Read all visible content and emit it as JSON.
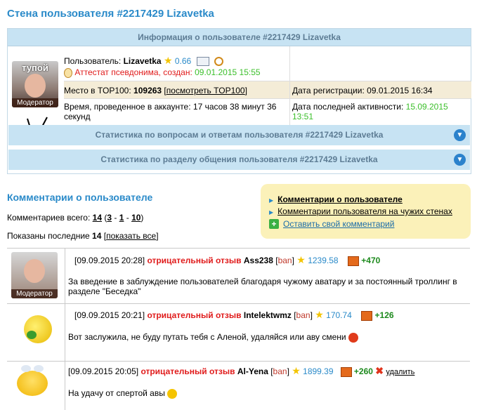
{
  "page_title": "Стена пользователя #2217429 Lizavetka",
  "info": {
    "header": "Информация о пользователе #2217429 Lizavetka",
    "avatar_caption_top": "тупой",
    "avatar_caption": "Модератор",
    "user_label": "Пользователь:",
    "user_name": "Lizavetka",
    "user_rating": "0.66",
    "attest_label": "Аттестат псевдонима, создан:",
    "attest_date": "09.01.2015 15:55",
    "top_label": "Место в TOP100:",
    "top_value": "109263",
    "top_link": "посмотреть TOP100",
    "reg_label": "Дата регистрации:",
    "reg_value": "09.01.2015 16:34",
    "time_label": "Время, проведенное в аккаунте:",
    "time_value": "17 часов 38 минут 36 секунд",
    "last_label": "Дата последней активности:",
    "last_value": "15.09.2015 13:51",
    "stats1": "Статистика по вопросам и ответам пользователя #2217429 Lizavetka",
    "stats2": "Статистика по разделу общения пользователя #2217429 Lizavetka"
  },
  "comments": {
    "heading": "Комментарии о пользователе",
    "total_label": "Комментариев всего:",
    "total": "14",
    "pos": "3",
    "neu": "1",
    "neg": "10",
    "shown_label": "Показаны последние",
    "shown_count": "14",
    "show_all": "показать все",
    "menu": {
      "item1": "Комментарии о пользователе",
      "item2": "Комментарии пользователя на чужих стенах",
      "item3": "Оставить свой комментарий"
    },
    "rows": [
      {
        "date": "[09.09.2015 20:28]",
        "type": "отрицательный отзыв",
        "user": "Ass238",
        "ban": "ban",
        "rating": "1239.58",
        "score": "+470",
        "text": "За введение в заблуждение пользователей благодаря чужому аватару и за постоянный троллинг в разделе \"Беседка\"",
        "caption": "Модератор"
      },
      {
        "date": "[09.09.2015 20:21]",
        "type": "отрицательный отзыв",
        "user": "Intelektwmz",
        "ban": "ban",
        "rating": "170.74",
        "score": "+126",
        "text": "Вот заслужила, не буду путать тебя с Аленой, удаляйся или аву смени"
      },
      {
        "date": "[09.09.2015 20:05]",
        "type": "отрицательный отзыв",
        "user": "Al-Yena",
        "ban": "ban",
        "rating": "1899.39",
        "score": "+260",
        "delete": "удалить",
        "text": "На удачу от спертой авы"
      }
    ]
  },
  "colors": {
    "accent": "#2a8ac9",
    "negative": "#e01b1b",
    "positive": "#3bbf2a"
  }
}
